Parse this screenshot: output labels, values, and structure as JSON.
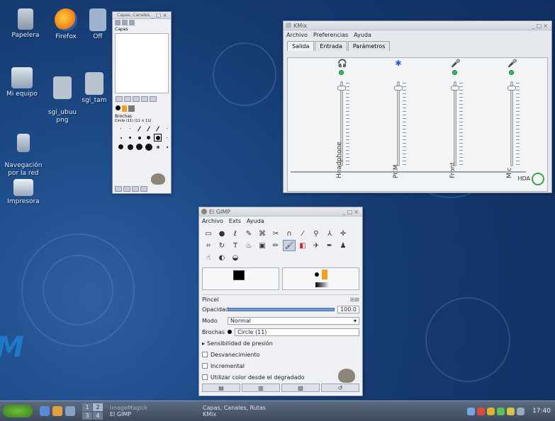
{
  "desktop": {
    "icons": [
      {
        "id": "trash",
        "label": "Papelera",
        "icon": "trash-icon"
      },
      {
        "id": "firefox",
        "label": "Firefox",
        "icon": "firefox-icon"
      },
      {
        "id": "office",
        "label": "Off",
        "icon": "office-icon"
      },
      {
        "id": "mycomputer",
        "label": "Mi equipo",
        "icon": "computer-icon"
      },
      {
        "id": "sgi1",
        "label": "sgi_ubuu\npng",
        "icon": "image-file-icon"
      },
      {
        "id": "sgi2",
        "label": "sgi_tam",
        "icon": "image-file-icon"
      },
      {
        "id": "network",
        "label": "Navegación\npor la red",
        "icon": "network-icon"
      },
      {
        "id": "printer",
        "label": "Impresora",
        "icon": "printer-icon"
      }
    ]
  },
  "kmix": {
    "title": "KMix",
    "menu": [
      "Archivo",
      "Preferencias",
      "Ayuda"
    ],
    "tabs": [
      "Salida",
      "Entrada",
      "Parámetros"
    ],
    "active_tab": "Salida",
    "channels": [
      {
        "name": "Headphone",
        "icon": "headphone-icon",
        "level": 0.95
      },
      {
        "name": "PCM",
        "icon": "pcm-icon",
        "level": 0.95
      },
      {
        "name": "Front",
        "icon": "microphone-icon",
        "level": 0.95
      },
      {
        "name": "Mic",
        "icon": "microphone-icon",
        "level": 0.95
      }
    ],
    "device_label": "HDA"
  },
  "gimp": {
    "title": "El GIMP",
    "menu": [
      "Archivo",
      "Exts",
      "Ayuda"
    ],
    "tool_options": {
      "panel_title": "Pincel",
      "opacity_label": "Opacidad",
      "opacity_value": "100.0",
      "mode_label": "Modo",
      "mode_value": "Normal",
      "brushes_label": "Brochas",
      "brush_value": "Circle (11)",
      "pressure_label": "Sensibilidad de presión",
      "fade_label": "Desvanecimiento",
      "incremental_label": "Incremental",
      "gradient_label": "Utilizar color desde el degradado"
    }
  },
  "layers": {
    "title": "Capas, Canales, Rutas",
    "tab_label": "Capas",
    "brushes_label": "Brochas",
    "brush_name": "Circle (11) (11 × 11)"
  },
  "taskbar": {
    "pager": [
      "1",
      "2",
      "3",
      "4"
    ],
    "tasks": [
      {
        "top": "ImageMagick",
        "bottom": "El GIMP"
      },
      {
        "top": "Capas, Canales, Rutas",
        "bottom": "KMix"
      }
    ],
    "clock": "17:40"
  },
  "left_edge_text": "M"
}
